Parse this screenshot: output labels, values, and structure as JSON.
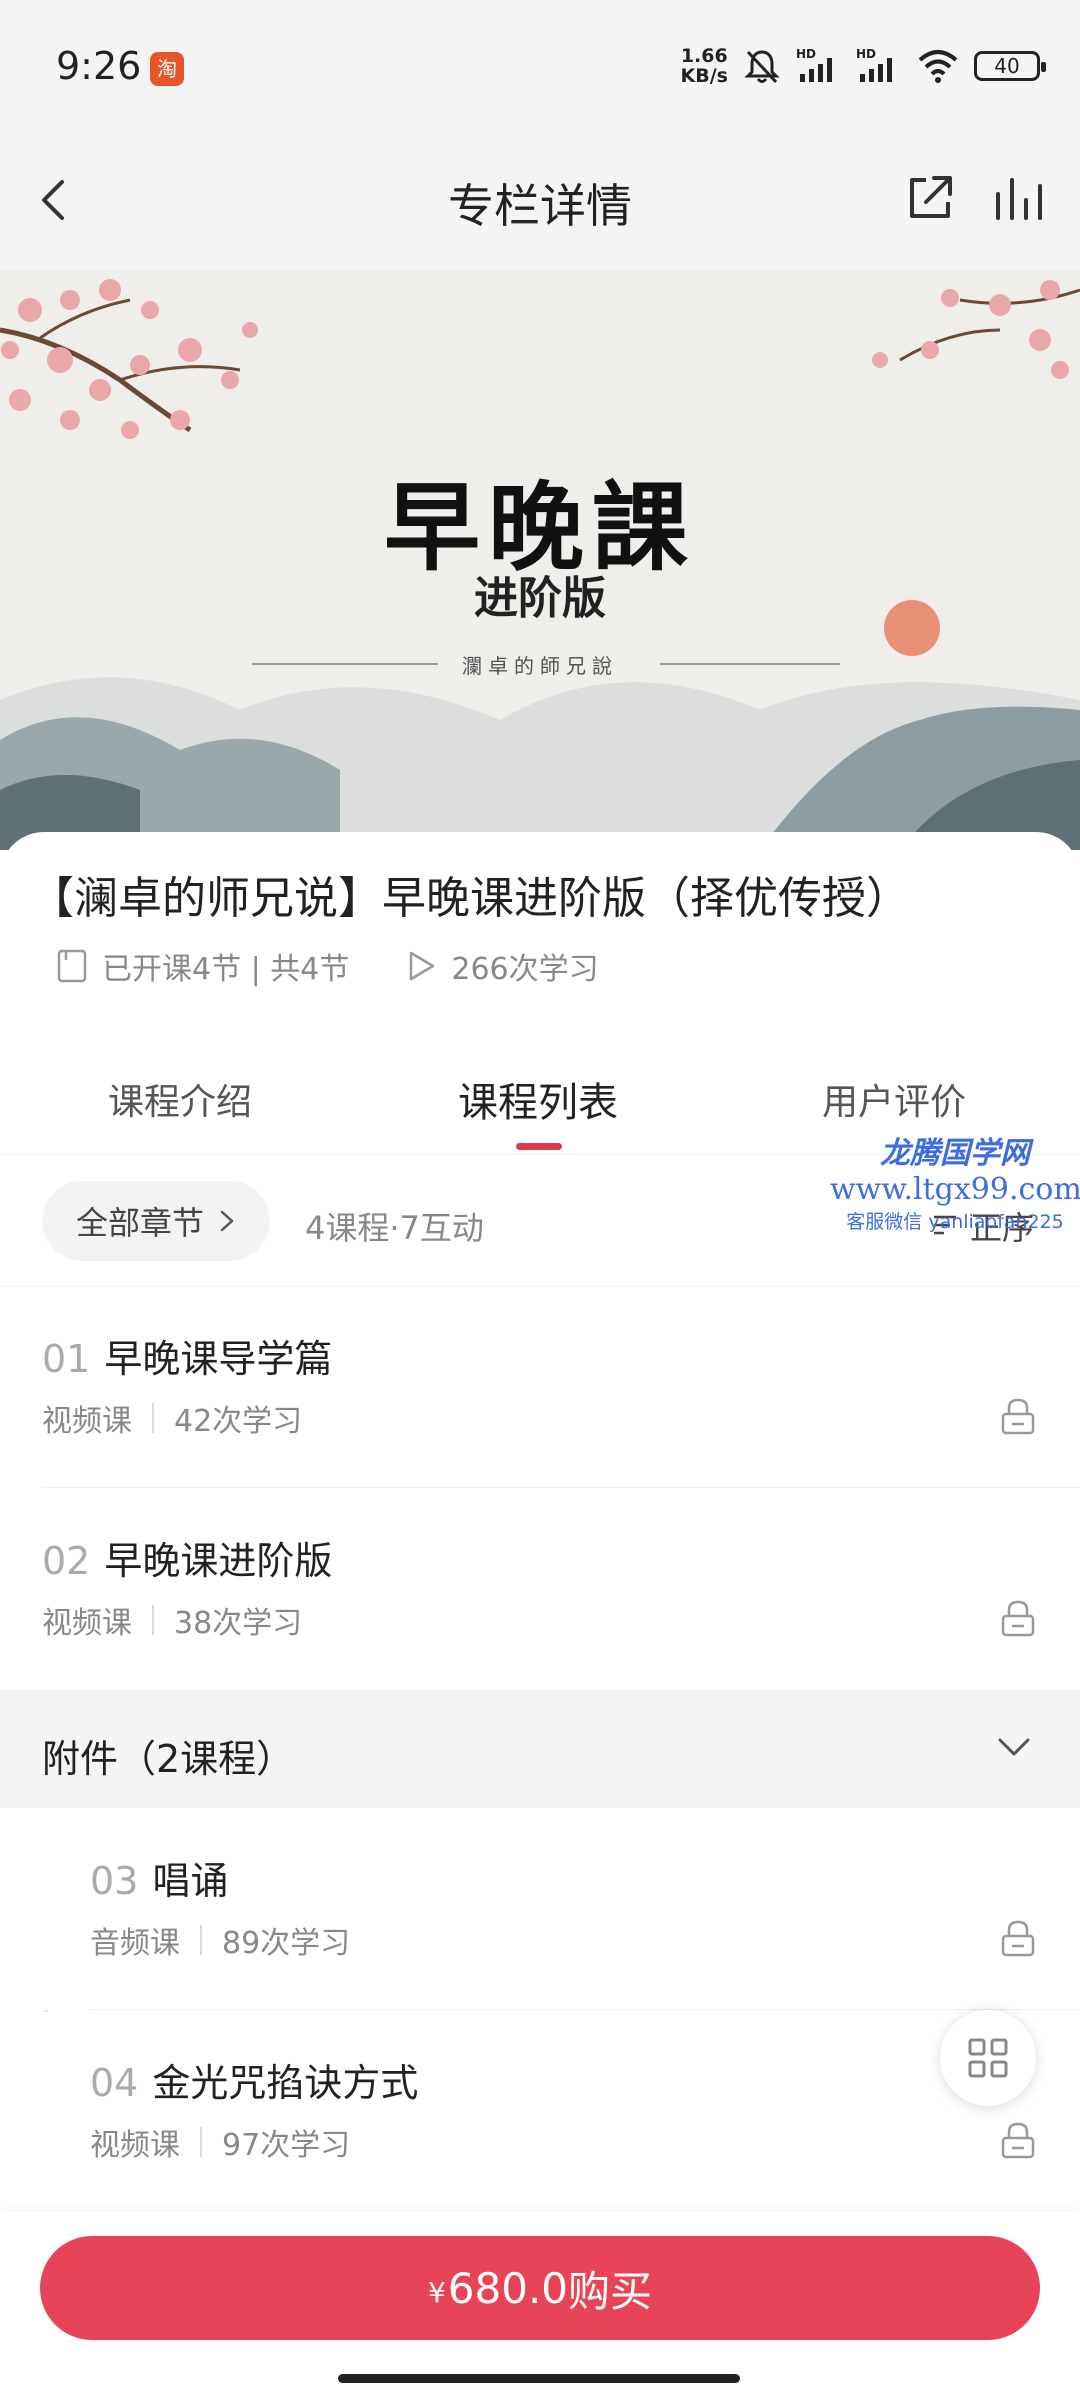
{
  "status_bar": {
    "time": "9:26",
    "app_icon_text": "淘",
    "net_speed_value": "1.66",
    "net_speed_unit": "KB/s",
    "signal_label": "HD",
    "battery": "40"
  },
  "nav": {
    "title": "专栏详情"
  },
  "banner": {
    "title": "早晚課",
    "subtitle": "进阶版",
    "author": "瀾卓的師兄說"
  },
  "course": {
    "title": "【澜卓的师兄说】早晚课进阶版（择优传授）",
    "lessons_opened": "已开课4节 | 共4节",
    "study_count": "266次学习"
  },
  "tabs": [
    {
      "label": "课程介绍"
    },
    {
      "label": "课程列表"
    },
    {
      "label": "用户评价"
    }
  ],
  "active_tab": "课程列表",
  "filter": {
    "chip_label": "全部章节",
    "count_text": "4课程·7互动",
    "sort_label": "正序"
  },
  "watermark": {
    "line1": "龙腾国学网",
    "line2": "www.ltgx99.com",
    "line3": "客服微信 yanliaofan225"
  },
  "lessons": [
    {
      "num": "01",
      "title": "早晚课导学篇",
      "type": "视频课",
      "count": "42次学习"
    },
    {
      "num": "02",
      "title": "早晚课进阶版",
      "type": "视频课",
      "count": "38次学习"
    },
    {
      "num": "03",
      "title": "唱诵",
      "type": "音频课",
      "count": "89次学习"
    },
    {
      "num": "04",
      "title": "金光咒掐诀方式",
      "type": "视频课",
      "count": "97次学习"
    }
  ],
  "attachment": {
    "title": "附件（2课程）"
  },
  "purchase": {
    "currency": "¥",
    "price": "680.0",
    "label": "购买"
  },
  "colors": {
    "accent": "#e84457",
    "tab_underline": "#e0394b",
    "watermark": "#3d6de0"
  }
}
